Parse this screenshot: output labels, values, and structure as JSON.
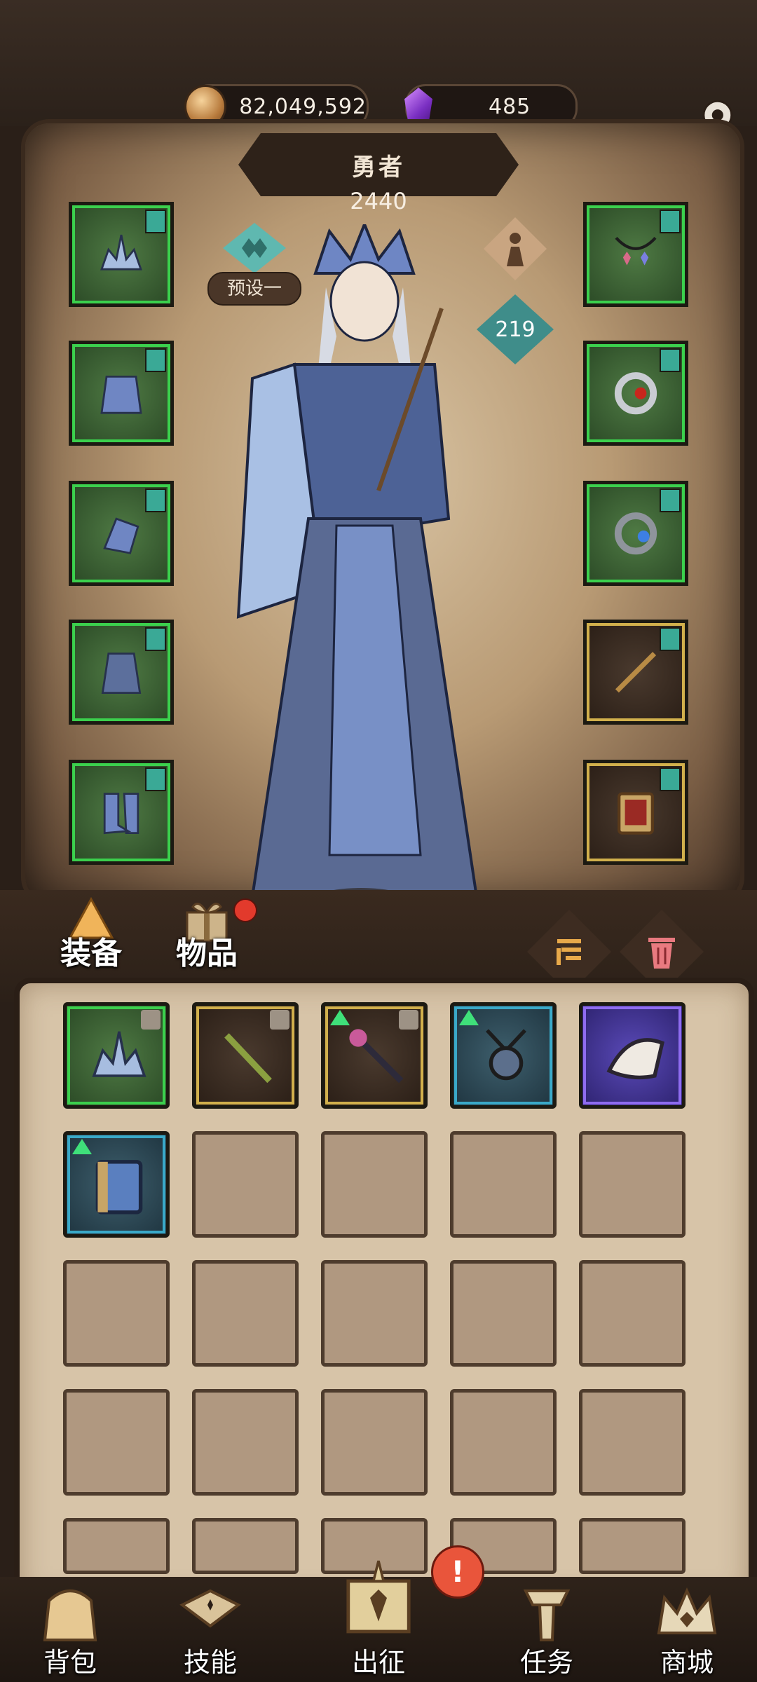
{
  "currencies": {
    "gold": "82,049,592",
    "gems": "485"
  },
  "hero": {
    "title": "勇者",
    "power": "2440",
    "preset_label": "预设一",
    "level": "219"
  },
  "tabs": {
    "equipment": "装备",
    "items": "物品"
  },
  "bottom_nav": {
    "bag": "背包",
    "skills": "技能",
    "expedition": "出征",
    "quests": "任务",
    "shop": "商城"
  },
  "alerts": {
    "expedition_badge": "!"
  },
  "colors": {
    "rarity_green": "#3bd04d",
    "rarity_gold": "#d1b04c",
    "rarity_blue": "#3aa9c8",
    "rarity_purple": "#8f6cf0",
    "accent_teal": "#3f8d8a"
  }
}
